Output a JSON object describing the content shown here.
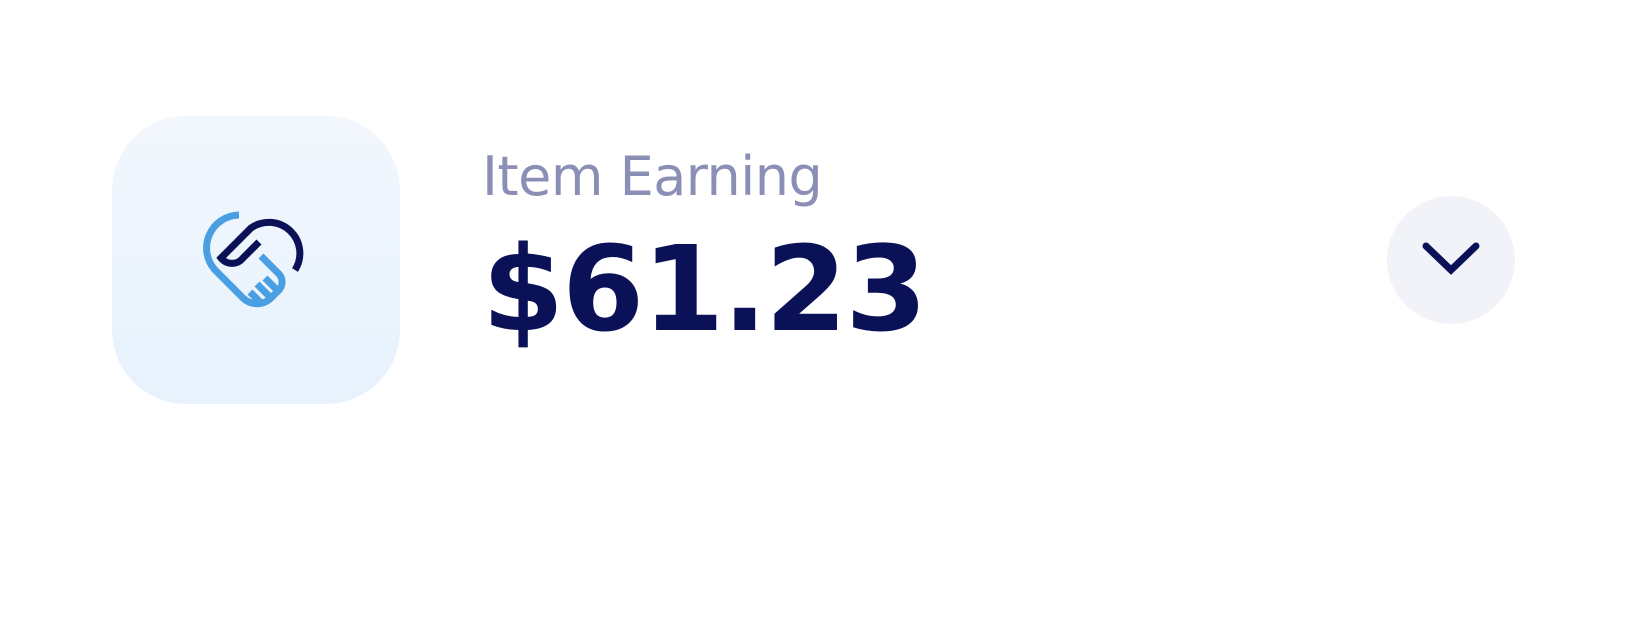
{
  "widget": {
    "icon": "handshake-icon",
    "label": "Item Earning",
    "value": "$61.23",
    "expand_icon": "chevron-down-icon"
  },
  "colors": {
    "label": "#8b8fb6",
    "value": "#0b1157",
    "icon_primary": "#0b1157",
    "icon_accent": "#4a9fe3",
    "icon_tile_bg": "#eaf4fd",
    "button_bg": "#f2f3f8"
  }
}
